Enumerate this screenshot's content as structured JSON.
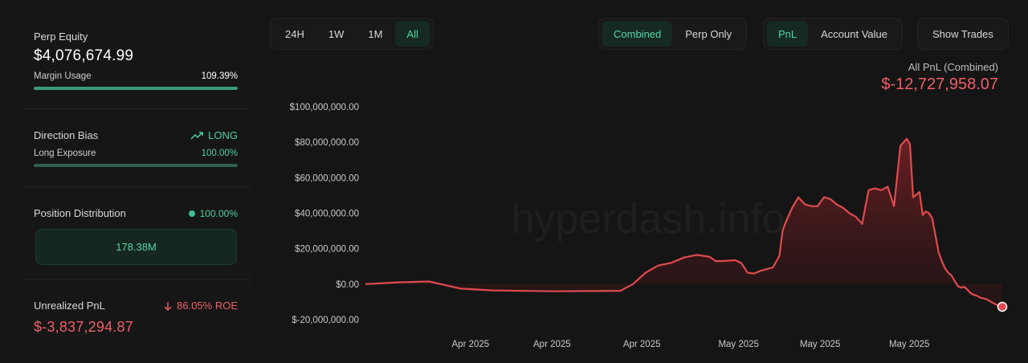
{
  "sidebar": {
    "equity": {
      "label": "Perp Equity",
      "value": "$4,076,674.99",
      "margin_label": "Margin Usage",
      "margin_value": "109.39%",
      "margin_fill": 1.0
    },
    "bias": {
      "label": "Direction Bias",
      "value": "LONG",
      "exposure_label": "Long Exposure",
      "exposure_value": "100.00%",
      "exposure_fill": 1.0,
      "icon": "trending-up-icon"
    },
    "distribution": {
      "label": "Position Distribution",
      "value": "100.00%",
      "box_value": "178.38M",
      "icon": "dot-icon"
    },
    "unrealized": {
      "label": "Unrealized PnL",
      "roe": "86.05% ROE",
      "value": "$-3,837,294.87",
      "icon": "arrow-down-icon"
    }
  },
  "toolbar": {
    "ranges": [
      "24H",
      "1W",
      "1M",
      "All"
    ],
    "active_range": "All",
    "modes": [
      "Combined",
      "Perp Only"
    ],
    "active_mode": "Combined",
    "metrics": [
      "PnL",
      "Account Value"
    ],
    "active_metric": "PnL",
    "show_trades": "Show Trades"
  },
  "chart_header": {
    "title": "All PnL (Combined)",
    "total": "$-12,727,958.07"
  },
  "watermark": "hyperdash.info",
  "colors": {
    "accent": "#55d6a6",
    "negative": "#ee5f66",
    "line": "#e04a4f"
  },
  "chart_data": {
    "type": "area",
    "title": "All PnL (Combined)",
    "ylabel": "",
    "xlabel": "",
    "ylim": [
      -20000000,
      100000000
    ],
    "yticks": [
      "$100,000,000.00",
      "$80,000,000.00",
      "$60,000,000.00",
      "$40,000,000.00",
      "$20,000,000.00",
      "$0.00",
      "$-20,000,000.00"
    ],
    "ytick_values": [
      100000000,
      80000000,
      60000000,
      40000000,
      20000000,
      0,
      -20000000
    ],
    "xticks": [
      "Apr 2025",
      "Apr 2025",
      "Apr 2025",
      "May 2025",
      "May 2025",
      "May 2025"
    ],
    "xtick_positions": [
      0.165,
      0.293,
      0.434,
      0.586,
      0.714,
      0.854
    ],
    "grid": false,
    "series": [
      {
        "x": [
          0,
          0.05,
          0.1,
          0.15,
          0.2,
          0.25,
          0.3,
          0.35,
          0.4,
          0.42,
          0.44,
          0.46,
          0.48,
          0.5,
          0.52,
          0.54,
          0.55,
          0.56,
          0.58,
          0.59,
          0.6,
          0.61,
          0.62,
          0.63,
          0.64,
          0.65,
          0.655,
          0.66,
          0.67,
          0.68,
          0.69,
          0.7,
          0.71,
          0.72,
          0.73,
          0.74,
          0.75,
          0.76,
          0.77,
          0.78,
          0.79,
          0.8,
          0.81,
          0.82,
          0.83,
          0.84,
          0.85,
          0.855,
          0.86,
          0.87,
          0.875,
          0.88,
          0.885,
          0.89,
          0.9,
          0.905,
          0.91,
          0.915,
          0.92,
          0.925,
          0.93,
          0.935,
          0.94,
          0.945,
          0.95,
          0.955,
          0.96,
          0.965,
          0.97,
          0.975,
          0.98,
          0.985,
          0.99,
          0.995,
          1.0
        ],
        "values": [
          0,
          1000000,
          1500000,
          -2500000,
          -3500000,
          -3800000,
          -4000000,
          -3900000,
          -3800000,
          0,
          6500000,
          10500000,
          12000000,
          15000000,
          16500000,
          15500000,
          13000000,
          13000000,
          13500000,
          12000000,
          6500000,
          6000000,
          7500000,
          8500000,
          9500000,
          16000000,
          30000000,
          35000000,
          43000000,
          49000000,
          45000000,
          44000000,
          44000000,
          49000000,
          48000000,
          45000000,
          43000000,
          40000000,
          38000000,
          34000000,
          53000000,
          54000000,
          53000000,
          55000000,
          44000000,
          78000000,
          82000000,
          79000000,
          49000000,
          52000000,
          39000000,
          41000000,
          40000000,
          37000000,
          18000000,
          13000000,
          9000000,
          6500000,
          5000000,
          2000000,
          -1000000,
          -2000000,
          -1500000,
          -3000000,
          -5000000,
          -6000000,
          -6500000,
          -7500000,
          -8000000,
          -8500000,
          -9500000,
          -10500000,
          -11500000,
          -12200000,
          -12727958
        ]
      }
    ]
  }
}
